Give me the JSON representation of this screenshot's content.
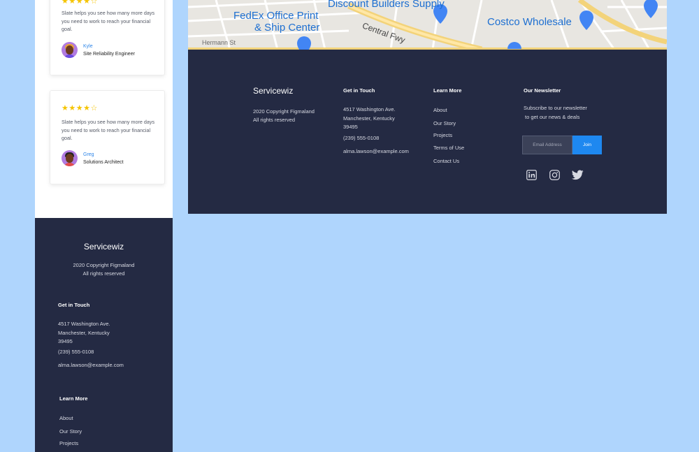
{
  "testimonials": [
    {
      "rating": 4,
      "text": "Slate helps you see how many more days you need to work to reach your financial goal.",
      "name": "Kyle",
      "role": "Site Reliability Engineer"
    },
    {
      "rating": 4,
      "text": "Slate helps you see how many more days you need to work to reach your financial goal.",
      "name": "Greg",
      "role": "Solutions Architect"
    }
  ],
  "map": {
    "labels": [
      "FedEx Office Print",
      "& Ship Center",
      "Discount Builders Supply",
      "Costco Wholesale",
      "Central Fwy",
      "Hermann St"
    ]
  },
  "footer": {
    "brand": "Servicewiz",
    "copyright_line1": "2020 Copyright Figmaland",
    "copyright_line2": "All rights reserved",
    "contact": {
      "heading": "Get in Touch",
      "address_line1": "4517 Washington Ave.",
      "address_line2": "Manchester, Kentucky",
      "address_line3": "39495",
      "phone": "(239) 555-0108",
      "email": "alma.lawson@example.com"
    },
    "learn_more": {
      "heading": "Learn More",
      "links": [
        "About",
        "Our Story",
        "Projects",
        "Terms of Use",
        "Contact Us"
      ]
    },
    "newsletter": {
      "heading": "Our Newsletter",
      "description_line1": "Subscribe to our newsletter",
      "description_line2": "to get our news & deals",
      "email_placeholder": "Email Address",
      "join_label": "Join"
    },
    "socials": [
      "linkedin-icon",
      "instagram-icon",
      "twitter-icon"
    ]
  },
  "colors": {
    "background": "#afd5fd",
    "footer_bg": "#242a43",
    "accent": "#1e88f0",
    "star": "#f5c400"
  }
}
